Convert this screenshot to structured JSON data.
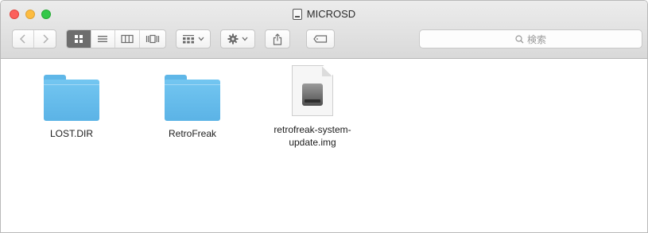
{
  "window": {
    "title": "MICROSD"
  },
  "toolbar": {
    "back_icon": "chevron-left-icon",
    "forward_icon": "chevron-right-icon",
    "view_modes": [
      "icon-view-icon",
      "list-view-icon",
      "column-view-icon",
      "cover-flow-icon"
    ],
    "active_view": "icon-view-icon",
    "group_icon": "group-arrange-icon",
    "action_icon": "gear-icon",
    "share_icon": "share-icon",
    "tag_icon": "tag-icon",
    "search": {
      "placeholder": "検索"
    }
  },
  "files": [
    {
      "name": "LOST.DIR",
      "kind": "folder"
    },
    {
      "name": "RetroFreak",
      "kind": "folder"
    },
    {
      "name": "retrofreak-system-update.img",
      "kind": "disk-image",
      "label_line1": "retrofreak-system-",
      "label_line2": "update.img"
    }
  ],
  "colors": {
    "folder": "#6ec2ef",
    "close": "#fc605c",
    "minimize": "#fdbc40",
    "maximize": "#34c84a",
    "active_segment": "#6d6d6d"
  }
}
